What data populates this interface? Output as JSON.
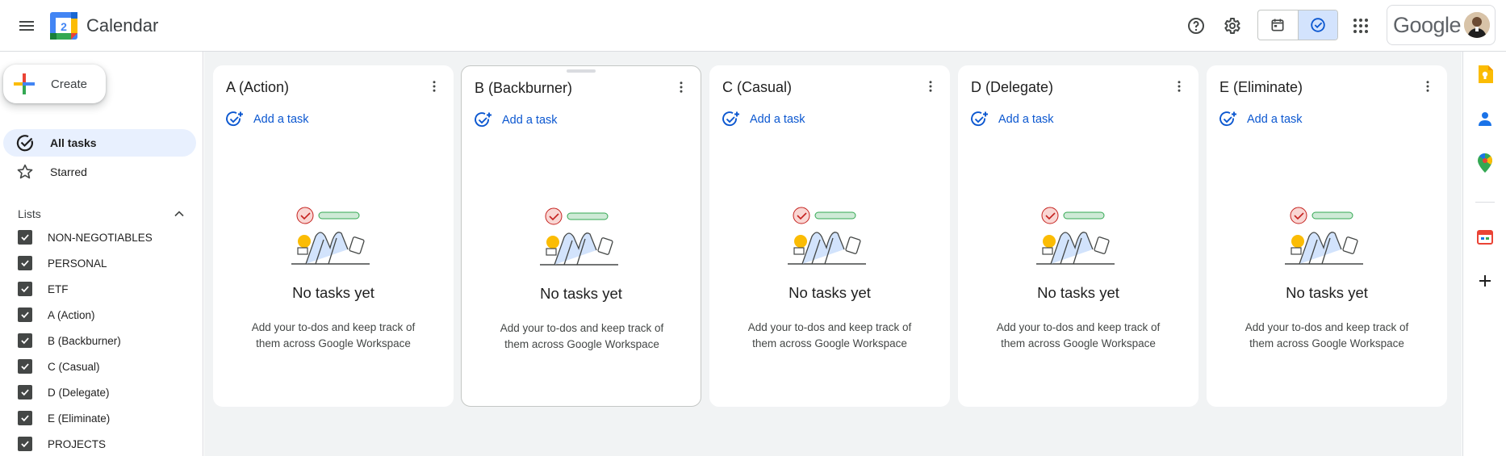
{
  "header": {
    "app_title": "Calendar",
    "logo_day": "2",
    "google_word": "Google",
    "view_switch": {
      "active": "tasks"
    }
  },
  "sidebar": {
    "create_label": "Create",
    "nav": [
      {
        "label": "All tasks",
        "active": true
      },
      {
        "label": "Starred",
        "active": false
      }
    ],
    "lists_header": "Lists",
    "lists": [
      {
        "label": "NON-NEGOTIABLES",
        "checked": true
      },
      {
        "label": "PERSONAL",
        "checked": true
      },
      {
        "label": "ETF",
        "checked": true
      },
      {
        "label": "A (Action)",
        "checked": true
      },
      {
        "label": "B (Backburner)",
        "checked": true
      },
      {
        "label": "C (Casual)",
        "checked": true
      },
      {
        "label": "D (Delegate)",
        "checked": true
      },
      {
        "label": "E (Eliminate)",
        "checked": true
      },
      {
        "label": "PROJECTS",
        "checked": true
      }
    ]
  },
  "columns": [
    {
      "title": "A (Action)",
      "add_label": "Add a task",
      "empty_title": "No tasks yet",
      "empty_line1": "Add your to-dos and keep track of",
      "empty_line2": "them across Google Workspace"
    },
    {
      "title": "B (Backburner)",
      "add_label": "Add a task",
      "empty_title": "No tasks yet",
      "empty_line1": "Add your to-dos and keep track of",
      "empty_line2": "them across Google Workspace"
    },
    {
      "title": "C (Casual)",
      "add_label": "Add a task",
      "empty_title": "No tasks yet",
      "empty_line1": "Add your to-dos and keep track of",
      "empty_line2": "them across Google Workspace"
    },
    {
      "title": "D (Delegate)",
      "add_label": "Add a task",
      "empty_title": "No tasks yet",
      "empty_line1": "Add your to-dos and keep track of",
      "empty_line2": "them across Google Workspace"
    },
    {
      "title": "E (Eliminate)",
      "add_label": "Add a task",
      "empty_title": "No tasks yet",
      "empty_line1": "Add your to-dos and keep track of",
      "empty_line2": "them across Google Workspace"
    }
  ],
  "colors": {
    "accent_blue": "#0b57d0",
    "active_nav": "#e8f0fe",
    "board_bg": "#f1f3f4"
  },
  "icons": {
    "header": [
      "menu-icon",
      "help-icon",
      "settings-icon",
      "calendar-view-icon",
      "tasks-view-icon",
      "apps-grid-icon"
    ],
    "rail": [
      "keep-icon",
      "contacts-icon",
      "maps-icon",
      "calendar-addon-icon",
      "add-icon"
    ]
  }
}
